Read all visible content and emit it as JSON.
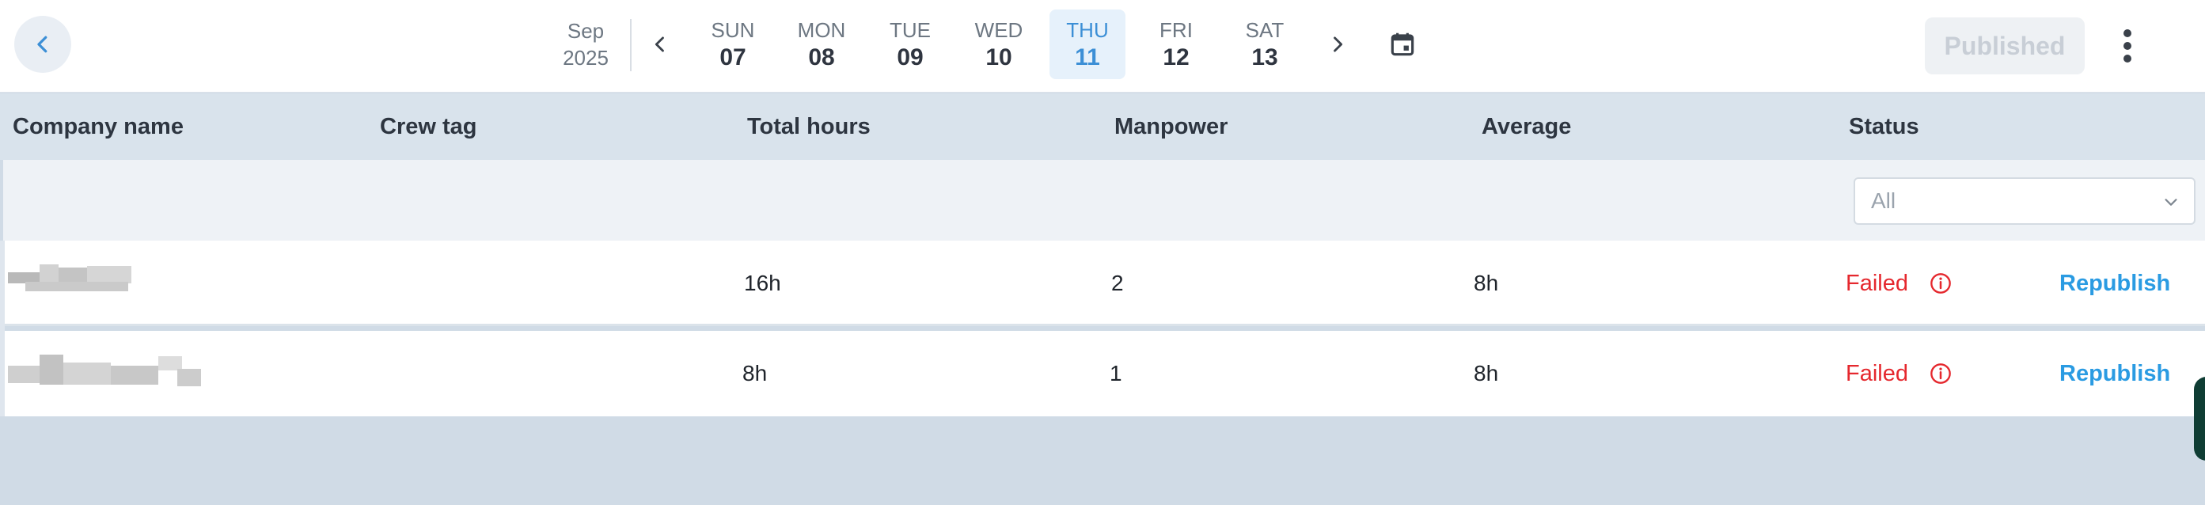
{
  "colors": {
    "accent": "#3c8fd6",
    "failed": "#e5282e",
    "link": "#2a9be2",
    "header_bg": "#d9e3ec"
  },
  "header": {
    "back_icon": "chevron-left-icon",
    "month": "Sep",
    "year": "2025",
    "prev_week_icon": "chevron-left-icon",
    "next_week_icon": "chevron-right-icon",
    "days": [
      {
        "dow": "SUN",
        "num": "07",
        "selected": false
      },
      {
        "dow": "MON",
        "num": "08",
        "selected": false
      },
      {
        "dow": "TUE",
        "num": "09",
        "selected": false
      },
      {
        "dow": "WED",
        "num": "10",
        "selected": false
      },
      {
        "dow": "THU",
        "num": "11",
        "selected": true
      },
      {
        "dow": "FRI",
        "num": "12",
        "selected": false
      },
      {
        "dow": "SAT",
        "num": "13",
        "selected": false
      }
    ],
    "calendar_icon": "calendar-icon",
    "published_label": "Published",
    "published_disabled": true,
    "more_icon": "kebab-menu-icon"
  },
  "table": {
    "columns": [
      "Company name",
      "Crew tag",
      "Total hours",
      "Manpower",
      "Average",
      "Status"
    ],
    "status_filter": {
      "value": "All",
      "icon": "chevron-down-icon"
    },
    "rows": [
      {
        "company": "",
        "crew_tag": "",
        "total_hours": "16h",
        "manpower": "2",
        "average": "8h",
        "status": "Failed",
        "status_icon": "info-circle-icon",
        "action": "Republish"
      },
      {
        "company": "",
        "crew_tag": "",
        "total_hours": "8h",
        "manpower": "1",
        "average": "8h",
        "status": "Failed",
        "status_icon": "info-circle-icon",
        "action": "Republish"
      }
    ]
  }
}
